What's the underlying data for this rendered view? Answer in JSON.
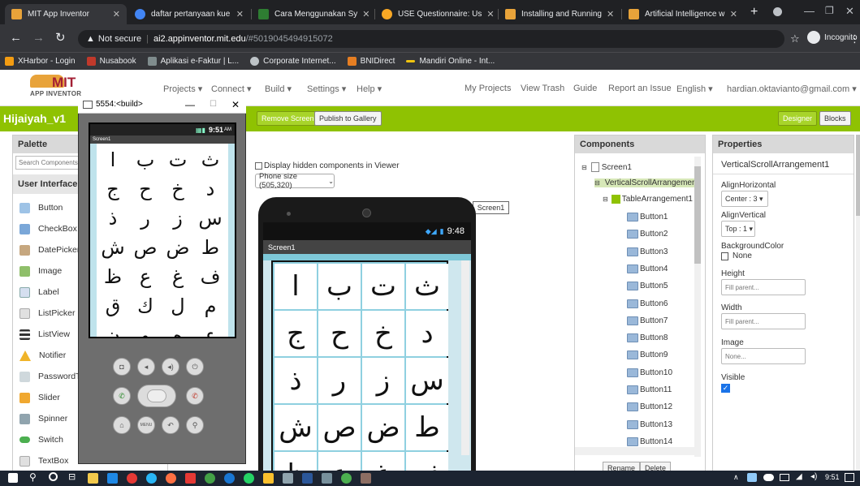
{
  "browser": {
    "tabs": [
      {
        "title": "MIT App Inventor",
        "color": "#e8a33a"
      },
      {
        "title": "daftar pertanyaan kue",
        "color": "#4285f4"
      },
      {
        "title": "Cara Menggunakan Sy",
        "color": "#2e7d32"
      },
      {
        "title": "USE Questionnaire: Us",
        "color": "#f9a825"
      },
      {
        "title": "Installing and Running",
        "color": "#e8a33a"
      },
      {
        "title": "Artificial Intelligence w",
        "color": "#e8a33a"
      }
    ],
    "new_tab": "+",
    "url_warning": "Not secure",
    "url_host": "ai2.appinventor.mit.edu",
    "url_path": "/#5019045494915072",
    "incognito": "Incognito",
    "bookmarks": [
      {
        "label": "XHarbor - Login",
        "color": "#f39c12"
      },
      {
        "label": "Nusabook",
        "color": "#c0392b"
      },
      {
        "label": "Aplikasi e-Faktur | L...",
        "color": "#7f8c8d"
      },
      {
        "label": "Corporate Internet...",
        "color": "#bdc3c7"
      },
      {
        "label": "BNIDirect",
        "color": "#e67e22"
      },
      {
        "label": "Mandiri Online - Int...",
        "color": "#f1c40f"
      }
    ]
  },
  "appinventor": {
    "logo_text": "MIT",
    "logo_sub": "APP INVENTOR",
    "menus": [
      "Projects ▾",
      "Connect ▾",
      "Build ▾",
      "Settings ▾",
      "Help ▾"
    ],
    "right_links": [
      "My Projects",
      "View Trash",
      "Guide",
      "Report an Issue",
      "English ▾",
      "hardian.oktavianto@gmail.com ▾"
    ],
    "project_name": "Hijaiyah_v1",
    "remove_screen": "Remove Screen",
    "publish": "Publish to Gallery",
    "designer": "Designer",
    "blocks": "Blocks"
  },
  "palette": {
    "title": "Palette",
    "search_placeholder": "Search Components...",
    "section": "User Interface",
    "items": [
      {
        "label": "Button",
        "color": "#9ec3e6"
      },
      {
        "label": "CheckBox",
        "color": "#7aa7d8"
      },
      {
        "label": "DatePicker",
        "color": "#c6a77f"
      },
      {
        "label": "Image",
        "color": "#8fbf6a"
      },
      {
        "label": "Label",
        "color": "#d5dff0"
      },
      {
        "label": "ListPicker",
        "color": "#e0e0e0"
      },
      {
        "label": "ListView",
        "color": "#333333"
      },
      {
        "label": "Notifier",
        "color": "#f0b429"
      },
      {
        "label": "PasswordTextBox",
        "color": "#cfd8dc"
      },
      {
        "label": "Slider",
        "color": "#f0a830"
      },
      {
        "label": "Spinner",
        "color": "#90a4ae"
      },
      {
        "label": "Switch",
        "color": "#4caf50"
      },
      {
        "label": "TextBox",
        "color": "#e0e0e0"
      }
    ],
    "help": "?"
  },
  "viewer": {
    "hidden_label": "Display hidden components in Viewer",
    "phone_size": "Phone size (505,320)",
    "screen_tag": "Screen1",
    "status_time": "9:48",
    "screen_title": "Screen1",
    "letters": [
      [
        "ا",
        "ب",
        "ت",
        "ث"
      ],
      [
        "ج",
        "ح",
        "خ",
        "د"
      ],
      [
        "ذ",
        "ر",
        "ز",
        "س"
      ],
      [
        "ش",
        "ص",
        "ض",
        "ط"
      ],
      [
        "ظ",
        "ع",
        "غ",
        "ف"
      ]
    ]
  },
  "components": {
    "title": "Components",
    "tree": [
      "Screen1",
      "VerticalScrollArrangement1",
      "TableArrangement1",
      "Button1",
      "Button2",
      "Button3",
      "Button4",
      "Button5",
      "Button6",
      "Button7",
      "Button8",
      "Button9",
      "Button10",
      "Button11",
      "Button12",
      "Button13",
      "Button14"
    ],
    "rename": "Rename",
    "delete": "Delete"
  },
  "properties": {
    "title": "Properties",
    "component": "VerticalScrollArrangement1",
    "align_h_label": "AlignHorizontal",
    "align_h_value": "Center : 3 ▾",
    "align_v_label": "AlignVertical",
    "align_v_value": "Top : 1 ▾",
    "bg_label": "BackgroundColor",
    "bg_value": "None",
    "height_label": "Height",
    "height_value": "Fill parent...",
    "width_label": "Width",
    "width_value": "Fill parent...",
    "image_label": "Image",
    "image_value": "None...",
    "visible_label": "Visible"
  },
  "emulator": {
    "title": "5554:<build>",
    "time": "9:51",
    "ampm": "AM",
    "screen": "Screen1",
    "letters": [
      [
        "ا",
        "ب",
        "ت",
        "ث"
      ],
      [
        "ج",
        "ح",
        "خ",
        "د"
      ],
      [
        "ذ",
        "ر",
        "ز",
        "س"
      ],
      [
        "ش",
        "ص",
        "ض",
        "ط"
      ],
      [
        "ظ",
        "ع",
        "غ",
        "ف"
      ],
      [
        "ق",
        "ك",
        "ل",
        "م"
      ],
      [
        "ن",
        "و",
        "ه",
        "ء"
      ]
    ],
    "menu_btn": "MENU"
  },
  "taskbar": {
    "time": "9:51"
  }
}
